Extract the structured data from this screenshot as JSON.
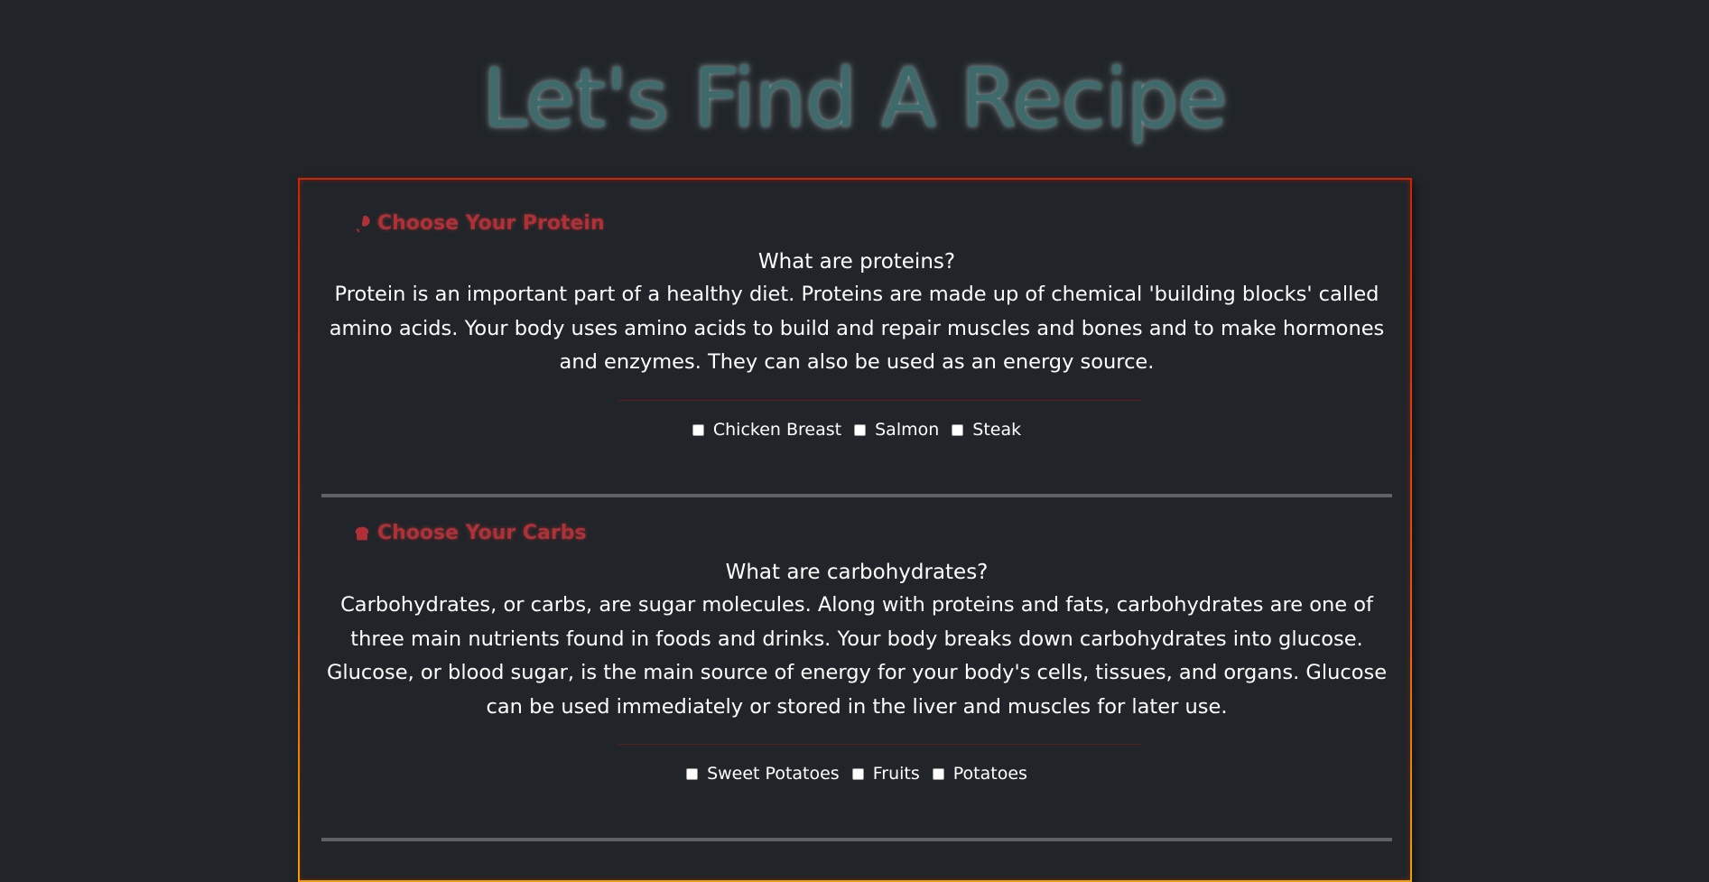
{
  "page": {
    "title": "Let's Find A Recipe"
  },
  "sections": [
    {
      "heading": "Choose Your Protein",
      "icon": "drumstick-icon",
      "question": "What are proteins?",
      "description": "Protein is an important part of a healthy diet. Proteins are made up of chemical 'building blocks' called amino acids. Your body uses amino acids to build and repair muscles and bones and to make hormones and enzymes. They can also be used as an energy source.",
      "options": [
        {
          "label": "Chicken Breast",
          "checked": false
        },
        {
          "label": "Salmon",
          "checked": false
        },
        {
          "label": "Steak",
          "checked": false
        }
      ]
    },
    {
      "heading": "Choose Your Carbs",
      "icon": "bread-icon",
      "question": "What are carbohydrates?",
      "description": "Carbohydrates, or carbs, are sugar molecules. Along with proteins and fats, carbohydrates are one of three main nutrients found in foods and drinks. Your body breaks down carbohydrates into glucose. Glucose, or blood sugar, is the main source of energy for your body's cells, tissues, and organs. Glucose can be used immediately or stored in the liver and muscles for later use.",
      "options": [
        {
          "label": "Sweet Potatoes",
          "checked": false
        },
        {
          "label": "Fruits",
          "checked": false
        },
        {
          "label": "Potatoes",
          "checked": false
        }
      ]
    }
  ],
  "colors": {
    "background": "#212529",
    "title": "#3e6a6c",
    "heading": "#b03037",
    "card_border_top": "#d62000",
    "card_border_bottom": "#f0a000"
  }
}
